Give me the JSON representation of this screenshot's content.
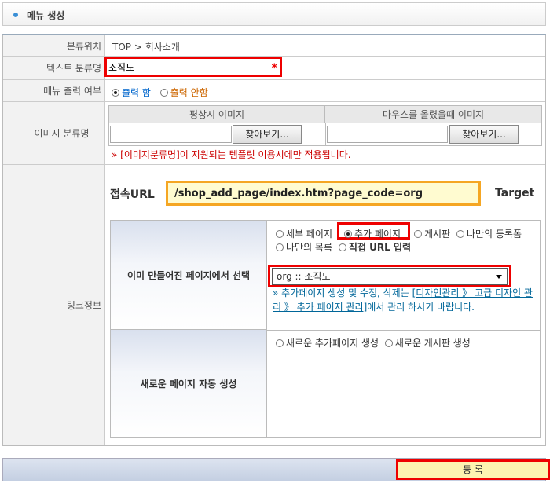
{
  "title": "메뉴 생성",
  "rows": {
    "location": {
      "label": "분류위치",
      "value": "TOP > 회사소개"
    },
    "text_name": {
      "label": "텍스트 분류명",
      "value": "조직도",
      "required": "*"
    },
    "menu_output": {
      "label": "메뉴 출력 여부",
      "on": "출력 함",
      "off": "출력 안함"
    },
    "image_name": {
      "label": "이미지 분류명",
      "col_normal": "평상시 이미지",
      "col_hover": "마우스를 올렸을때 이미지",
      "browse": "찾아보기...",
      "note": "[이미지분류명]이 지원되는 템플릿 이용시에만 적용됩니다."
    },
    "link": {
      "label": "링크정보"
    }
  },
  "link": {
    "url_label": "접속URL",
    "url_value": "/shop_add_page/index.htm?page_code=org",
    "target_label": "Target",
    "existing_label": "이미 만들어진 페이지에서 선택",
    "options": [
      "세부 페이지",
      "추가 페이지",
      "게시판",
      "나만의 등록폼",
      "나만의 목록",
      "직접 URL 입력"
    ],
    "select_value": "org :: 조직도",
    "help_prefix": "» 추가페이지 생성 및 수정, 삭제는 ",
    "help_link": "[디자인관리 》 고급 디자인 관리 》 추가 페이지 관리]",
    "help_suffix": "에서 관리 하시기 바랍니다.",
    "new_label": "새로운 페이지 자동 생성",
    "new_options": [
      "새로운 추가페이지 생성",
      "새로운 게시판 생성"
    ]
  },
  "submit": "등 록",
  "colors": {
    "accent": "#3a8fd6",
    "highlight": "#e00000",
    "url_border": "#f5a623"
  }
}
